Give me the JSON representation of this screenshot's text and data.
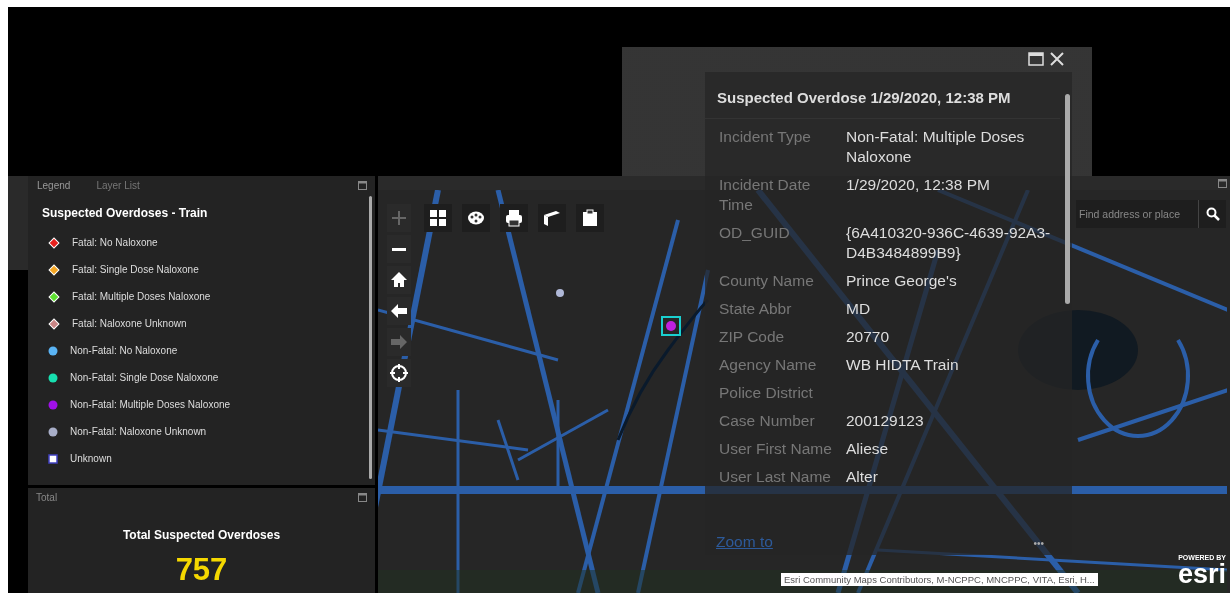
{
  "legend_panel": {
    "tabs": [
      {
        "label": "Legend",
        "selected": true
      },
      {
        "label": "Layer List",
        "selected": false
      }
    ],
    "layer_title": "Suspected Overdoses - Train",
    "items": [
      {
        "label": "Fatal: No Naloxone",
        "kind": "diamond",
        "color": "#e8211d"
      },
      {
        "label": "Fatal: Single Dose Naloxone",
        "kind": "diamond",
        "color": "#f5a623"
      },
      {
        "label": "Fatal: Multiple Doses Naloxone",
        "kind": "diamond",
        "color": "#5de030"
      },
      {
        "label": "Fatal: Naloxone Unknown",
        "kind": "diamond",
        "color": "#c98585"
      },
      {
        "label": "Non-Fatal: No Naloxone",
        "kind": "circle",
        "color": "#5ab4f5"
      },
      {
        "label": "Non-Fatal: Single Dose Naloxone",
        "kind": "circle",
        "color": "#17e0b0"
      },
      {
        "label": "Non-Fatal: Multiple Doses Naloxone",
        "kind": "circle",
        "color": "#a010e8"
      },
      {
        "label": "Non-Fatal: Naloxone Unknown",
        "kind": "circle",
        "color": "#a8aec8"
      },
      {
        "label": "Unknown",
        "kind": "square",
        "color": "#ffffff"
      }
    ]
  },
  "total_panel": {
    "title": "Total",
    "heading": "Total Suspected Overdoses",
    "value": "757"
  },
  "map": {
    "zoom_controls": [
      {
        "kind": "zoom-in",
        "disabled": true
      },
      {
        "kind": "zoom-out",
        "disabled": false
      },
      {
        "kind": "home",
        "disabled": false
      },
      {
        "kind": "back",
        "disabled": false
      },
      {
        "kind": "forward",
        "disabled": true
      },
      {
        "kind": "locate",
        "disabled": false
      }
    ],
    "tools": [
      {
        "kind": "basemap-gallery"
      },
      {
        "kind": "palette"
      },
      {
        "kind": "print"
      },
      {
        "kind": "measure"
      },
      {
        "kind": "clipboard"
      }
    ],
    "search": {
      "placeholder": "Find address or place"
    },
    "markers": [
      {
        "color": "#c020e0",
        "selected": true
      },
      {
        "color": "#b0b8d8",
        "selected": false
      }
    ],
    "attribution": "Esri Community Maps Contributors, M-NCPPC, MNCPPC, VITA, Esri, H...",
    "logo": {
      "tagline": "POWERED BY",
      "name": "esri"
    }
  },
  "popup": {
    "title": "Suspected Overdose 1/29/2020, 12:38 PM",
    "fields": [
      {
        "label": "Incident Type",
        "value": "Non-Fatal: Multiple Doses Naloxone"
      },
      {
        "label": "Incident Date Time",
        "value": "1/29/2020, 12:38 PM"
      },
      {
        "label": "OD_GUID",
        "value": "{6A410320-936C-4639-92A3-D4B3484899B9}"
      },
      {
        "label": "County Name",
        "value": "Prince George's"
      },
      {
        "label": "State Abbr",
        "value": "MD"
      },
      {
        "label": "ZIP Code",
        "value": "20770"
      },
      {
        "label": "Agency Name",
        "value": "WB HIDTA Train"
      },
      {
        "label": "Police District"
      },
      {
        "label": "Case Number",
        "value": "200129123"
      },
      {
        "label": "User First Name",
        "value": "Aliese"
      },
      {
        "label": "User Last Name",
        "value": "Alter"
      }
    ],
    "zoom_link": "Zoom to",
    "more": "•••"
  }
}
